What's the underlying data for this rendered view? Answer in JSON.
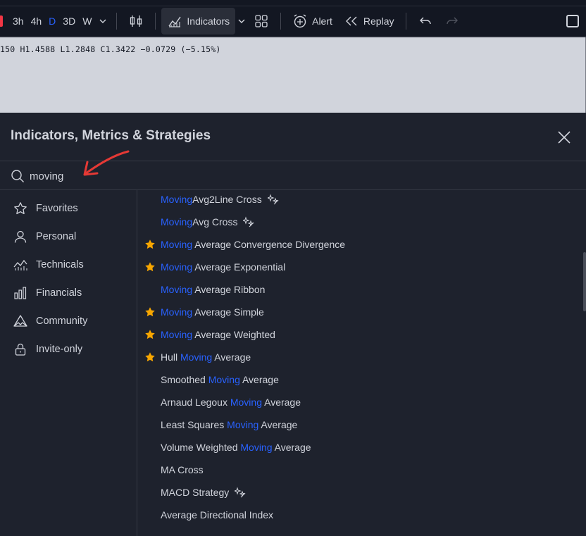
{
  "toolbar": {
    "timeframes": [
      {
        "label": "3h",
        "active": false
      },
      {
        "label": "4h",
        "active": false
      },
      {
        "label": "D",
        "active": true
      },
      {
        "label": "3D",
        "active": false
      },
      {
        "label": "W",
        "active": false
      }
    ],
    "indicators_label": "Indicators",
    "alert_label": "Alert",
    "replay_label": "Replay"
  },
  "chart": {
    "ohlc_text": "150 H1.4588 L1.2848 C1.3422 −0.0729 (−5.15%)"
  },
  "dialog": {
    "title": "Indicators, Metrics & Strategies",
    "search": {
      "value": "moving",
      "placeholder": "Search"
    },
    "sidebar": [
      {
        "label": "Favorites",
        "icon": "star-outline-icon"
      },
      {
        "label": "Personal",
        "icon": "user-icon"
      },
      {
        "label": "Technicals",
        "icon": "chart-line-icon"
      },
      {
        "label": "Financials",
        "icon": "bar-chart-icon"
      },
      {
        "label": "Community",
        "icon": "community-icon"
      },
      {
        "label": "Invite-only",
        "icon": "lock-icon"
      }
    ],
    "results": [
      {
        "parts": [
          {
            "t": "Moving",
            "hl": true
          },
          {
            "t": "Avg2Line Cross",
            "hl": false
          }
        ],
        "fav": false,
        "strategy": true
      },
      {
        "parts": [
          {
            "t": "Moving",
            "hl": true
          },
          {
            "t": "Avg Cross",
            "hl": false
          }
        ],
        "fav": false,
        "strategy": true
      },
      {
        "parts": [
          {
            "t": "Moving",
            "hl": true
          },
          {
            "t": " Average Convergence Divergence",
            "hl": false
          }
        ],
        "fav": true,
        "strategy": false
      },
      {
        "parts": [
          {
            "t": "Moving",
            "hl": true
          },
          {
            "t": " Average Exponential",
            "hl": false
          }
        ],
        "fav": true,
        "strategy": false
      },
      {
        "parts": [
          {
            "t": "Moving",
            "hl": true
          },
          {
            "t": " Average Ribbon",
            "hl": false
          }
        ],
        "fav": false,
        "strategy": false
      },
      {
        "parts": [
          {
            "t": "Moving",
            "hl": true
          },
          {
            "t": " Average Simple",
            "hl": false
          }
        ],
        "fav": true,
        "strategy": false
      },
      {
        "parts": [
          {
            "t": "Moving",
            "hl": true
          },
          {
            "t": " Average Weighted",
            "hl": false
          }
        ],
        "fav": true,
        "strategy": false
      },
      {
        "parts": [
          {
            "t": "Hull ",
            "hl": false
          },
          {
            "t": "Moving",
            "hl": true
          },
          {
            "t": " Average",
            "hl": false
          }
        ],
        "fav": true,
        "strategy": false
      },
      {
        "parts": [
          {
            "t": "Smoothed ",
            "hl": false
          },
          {
            "t": "Moving",
            "hl": true
          },
          {
            "t": " Average",
            "hl": false
          }
        ],
        "fav": false,
        "strategy": false
      },
      {
        "parts": [
          {
            "t": "Arnaud Legoux ",
            "hl": false
          },
          {
            "t": "Moving",
            "hl": true
          },
          {
            "t": " Average",
            "hl": false
          }
        ],
        "fav": false,
        "strategy": false
      },
      {
        "parts": [
          {
            "t": "Least Squares ",
            "hl": false
          },
          {
            "t": "Moving",
            "hl": true
          },
          {
            "t": " Average",
            "hl": false
          }
        ],
        "fav": false,
        "strategy": false
      },
      {
        "parts": [
          {
            "t": "Volume Weighted ",
            "hl": false
          },
          {
            "t": "Moving",
            "hl": true
          },
          {
            "t": " Average",
            "hl": false
          }
        ],
        "fav": false,
        "strategy": false
      },
      {
        "parts": [
          {
            "t": "MA Cross",
            "hl": false
          }
        ],
        "fav": false,
        "strategy": false
      },
      {
        "parts": [
          {
            "t": "MACD Strategy",
            "hl": false
          }
        ],
        "fav": false,
        "strategy": true
      },
      {
        "parts": [
          {
            "t": "Average Directional Index",
            "hl": false
          }
        ],
        "fav": false,
        "strategy": false
      }
    ]
  },
  "colors": {
    "accent": "#2962ff",
    "favorite_star": "#f7a600",
    "annotation_arrow": "#e53935"
  }
}
